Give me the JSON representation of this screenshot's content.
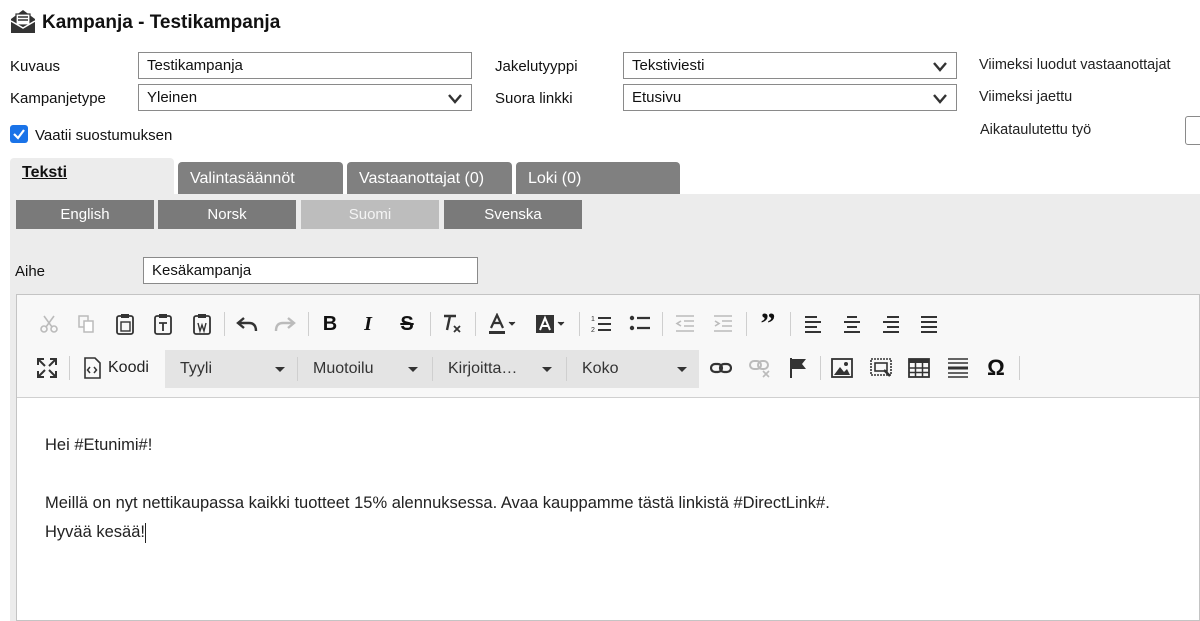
{
  "header": {
    "title": "Kampanja - Testikampanja",
    "icon": "campaign-envelope-icon"
  },
  "form": {
    "kuvaus_label": "Kuvaus",
    "kuvaus_value": "Testikampanja",
    "kampanjetype_label": "Kampanjetype",
    "kampanjetype_value": "Yleinen",
    "jakelutyyppi_label": "Jakelutyyppi",
    "jakelutyyppi_value": "Tekstiviesti",
    "suora_linkki_label": "Suora linkki",
    "suora_linkki_value": "Etusivu",
    "consent_label": "Vaatii suostumuksen",
    "consent_checked": true
  },
  "right_info": {
    "last_recipients_label": "Viimeksi luodut vastaanottajat",
    "last_sent_label": "Viimeksi jaettu",
    "scheduled_job_label": "Aikataulutettu työ"
  },
  "tabs": [
    {
      "label": "Teksti",
      "active": true
    },
    {
      "label": "Valintasäännöt",
      "active": false
    },
    {
      "label": "Vastaanottajat (0)",
      "active": false
    },
    {
      "label": "Loki (0)",
      "active": false
    }
  ],
  "languages": [
    {
      "label": "English",
      "active": false
    },
    {
      "label": "Norsk",
      "active": false
    },
    {
      "label": "Suomi",
      "active": true
    },
    {
      "label": "Svenska",
      "active": false
    }
  ],
  "subject": {
    "label": "Aihe",
    "value": "Kesäkampanja"
  },
  "editor": {
    "source_label": "Koodi",
    "combos": [
      "Tyyli",
      "Muotoilu",
      "Kirjoitta…",
      "Koko"
    ],
    "content_lines": [
      "Hei #Etunimi#!",
      "",
      "Meillä on nyt nettikaupassa kaikki tuotteet 15% alennuksessa. Avaa kauppamme tästä linkistä #DirectLink#.",
      "Hyvää kesää!"
    ]
  },
  "colors": {
    "accent": "#1a73e8",
    "tab_inactive": "#808080",
    "panel_bg": "#ececec"
  }
}
